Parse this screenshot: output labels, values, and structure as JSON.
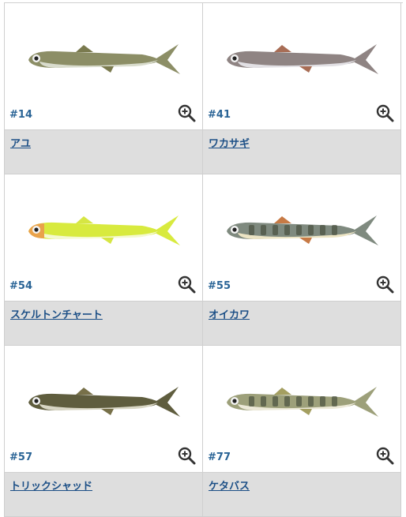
{
  "products": [
    {
      "code": "#14",
      "name": "アユ",
      "body": "#8c8e66",
      "belly": "#d9dccd",
      "fin": "#7a7a4e",
      "stripe": false
    },
    {
      "code": "#41",
      "name": "ワカサギ",
      "body": "#8f8483",
      "belly": "#e2e0e4",
      "fin": "#a86d55",
      "stripe": false
    },
    {
      "code": "#54",
      "name": "スケルトンチャート",
      "body": "#d8ea3e",
      "belly": "#f4f9cf",
      "fin": "#d6e643",
      "stripe": false,
      "head": "#e9a24a"
    },
    {
      "code": "#55",
      "name": "オイカワ",
      "body": "#7f8a7f",
      "belly": "#ece4c4",
      "fin": "#c77a45",
      "stripe": true
    },
    {
      "code": "#57",
      "name": "トリックシャッド",
      "body": "#5f5d3e",
      "belly": "#d8d6c4",
      "fin": "#777049",
      "stripe": false
    },
    {
      "code": "#77",
      "name": "ケタバス",
      "body": "#9da07a",
      "belly": "#ece9d8",
      "fin": "#a49f61",
      "stripe": true
    }
  ]
}
